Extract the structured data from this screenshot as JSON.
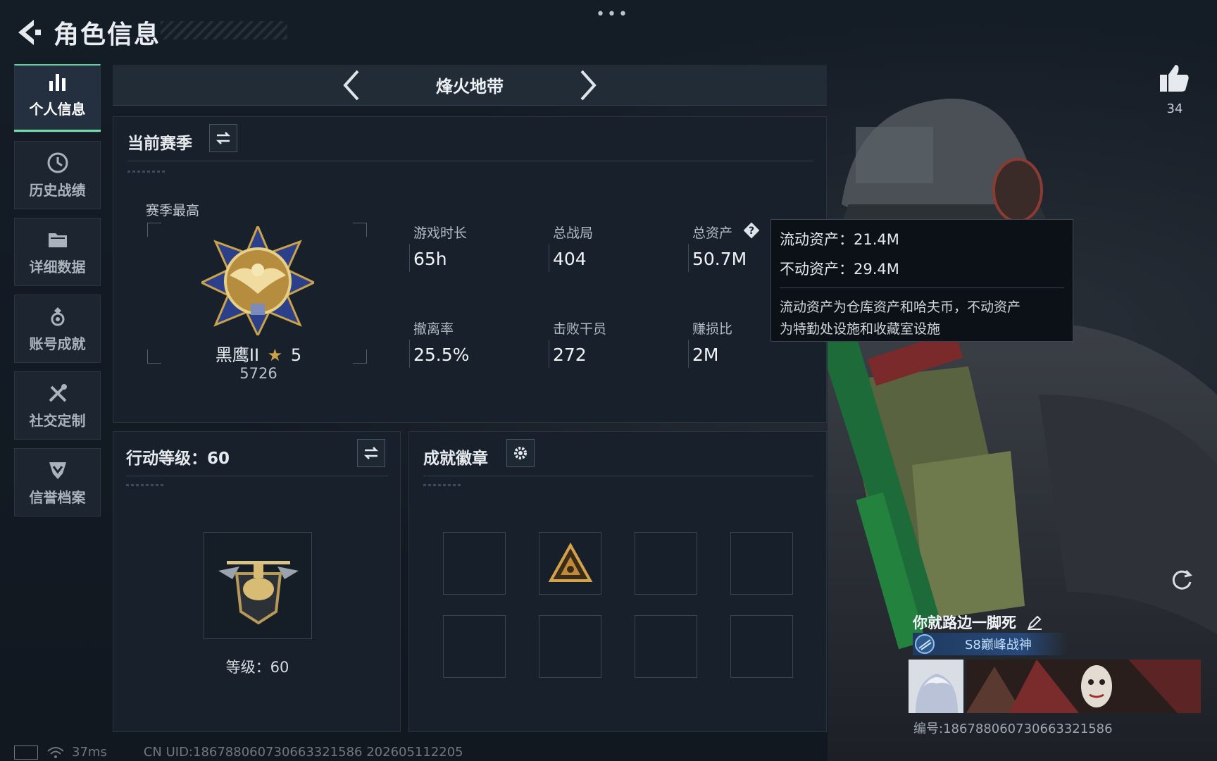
{
  "header": {
    "title": "角色信息",
    "more": "•••"
  },
  "sidebar": {
    "items": [
      {
        "label": "个人信息",
        "icon": "bar-chart-icon",
        "active": true
      },
      {
        "label": "历史战绩",
        "icon": "history-clock-icon",
        "active": false
      },
      {
        "label": "详细数据",
        "icon": "folder-icon",
        "active": false
      },
      {
        "label": "账号成就",
        "icon": "achievement-icon",
        "active": false
      },
      {
        "label": "社交定制",
        "icon": "tools-icon",
        "active": false
      },
      {
        "label": "信誉档案",
        "icon": "shield-check-icon",
        "active": false
      }
    ]
  },
  "mode": {
    "title": "烽火地带"
  },
  "season": {
    "title": "当前赛季",
    "best_label": "赛季最高",
    "rank_name": "黑鹰II",
    "rank_stars": "5",
    "rank_score": "5726",
    "stats": [
      {
        "key": "游戏时长",
        "value": "65h"
      },
      {
        "key": "总战局",
        "value": "404"
      },
      {
        "key": "总资产",
        "value": "50.7M"
      },
      {
        "key": "撤离率",
        "value": "25.5%"
      },
      {
        "key": "击败干员",
        "value": "272"
      },
      {
        "key": "赚损比",
        "value": "2M"
      }
    ]
  },
  "tooltip": {
    "liquid": "流动资产：21.4M",
    "fixed": "不动资产：29.4M",
    "desc_line1": "流动资产为仓库资产和哈夫币，不动资产",
    "desc_line2": "为特勤处设施和收藏室设施"
  },
  "level": {
    "title": "行动等级：60",
    "text": "等级：60"
  },
  "achievements": {
    "title": "成就徽章",
    "slots": 8,
    "filled_slot": 1
  },
  "like": {
    "count": "34"
  },
  "player": {
    "name": "你就路边一脚死",
    "title_badge": "S8巅峰战神",
    "id": "编号:186788060730663321586"
  },
  "status": {
    "ping": "37ms",
    "uid": "CN UID:186788060730663321586 202605112205"
  },
  "colors": {
    "background": "#121a24",
    "panel": "#18212b",
    "active_accent": "#6fe0a8",
    "gold": "#c9a24a"
  }
}
